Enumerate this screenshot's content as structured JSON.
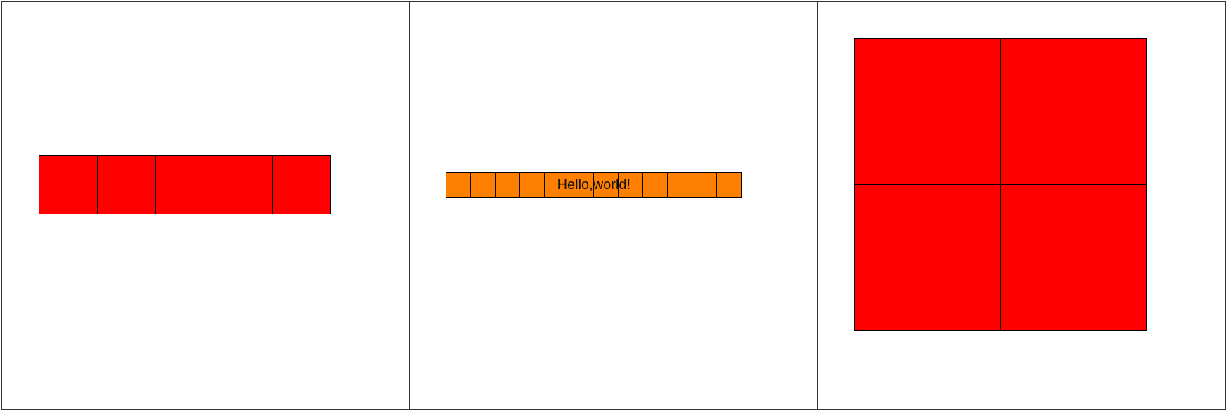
{
  "colors": {
    "red": "#ff0000",
    "orange": "#ff7f00",
    "border": "#000000"
  },
  "panels": [
    {
      "id": "left",
      "layout": "row",
      "count": 5,
      "fill": "red"
    },
    {
      "id": "middle",
      "layout": "row",
      "count": 12,
      "fill": "orange",
      "label": "Hello,world!"
    },
    {
      "id": "right",
      "layout": "grid",
      "rows": 2,
      "cols": 2,
      "fill": "red"
    }
  ]
}
